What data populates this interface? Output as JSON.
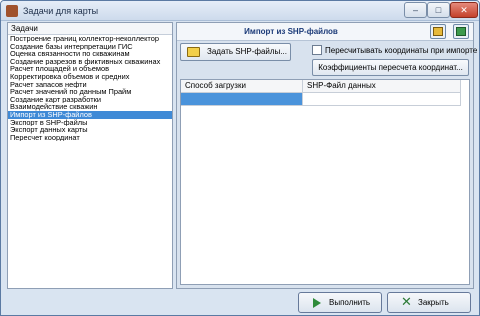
{
  "window": {
    "title": "Задачи для карты",
    "min_glyph": "–",
    "max_glyph": "□",
    "close_glyph": "✕"
  },
  "left": {
    "header": "Задачи",
    "items": [
      "Построение границ коллектор-неколлектор",
      "Создание базы интерпретации ГИС",
      "Оценка связанности по скважинам",
      "Создание разрезов в фиктивных скважинах",
      "Расчет площадей и объемов",
      "Корректировка объемов и средних",
      "Расчет запасов нефти",
      "Расчет значений по данным Прайм",
      "Создание карт разработки",
      "Взаимодействие скважин",
      "Импорт из SHP-файлов",
      "Экспорт в SHP-файлы",
      "Экспорт данных карты",
      "Пересчет координат"
    ],
    "selected_index": 10
  },
  "right": {
    "title": "Импорт из SHP-файлов",
    "set_files_button": "Задать SHP-файлы...",
    "recalc_checkbox_label": "Пересчитывать координаты при импорте",
    "recalc_checkbox_checked": false,
    "coefficients_button": "Коэффициенты пересчета координат...",
    "grid": {
      "columns": [
        "Способ загрузки",
        "SHP-Файл данных"
      ],
      "rows": [
        [
          "",
          ""
        ]
      ]
    }
  },
  "footer": {
    "run_button": "Выполнить",
    "close_button": "Закрыть"
  },
  "colors": {
    "selection": "#3f8ad6",
    "title_text": "#1b3a78"
  }
}
